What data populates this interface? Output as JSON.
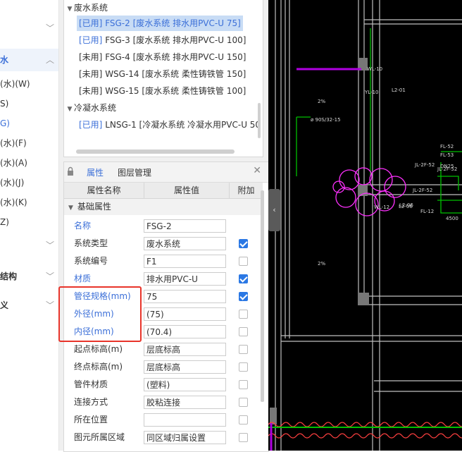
{
  "leftnav": {
    "items": [
      {
        "label": "",
        "chevron": true
      },
      {
        "label": "水",
        "chevron": true,
        "selected": true
      },
      {
        "label": "(水)(W)"
      },
      {
        "label": "S)"
      },
      {
        "label": "G)",
        "blue": true
      },
      {
        "label": "(水)(F)"
      },
      {
        "label": "(水)(A)"
      },
      {
        "label": "(水)(J)"
      },
      {
        "label": "(水)(K)"
      },
      {
        "label": "Z)"
      },
      {
        "label": "",
        "chevron": true
      },
      {
        "label": "结构",
        "chevron": true
      },
      {
        "label": "义",
        "chevron": true
      }
    ]
  },
  "tree": {
    "group1": "废水系统",
    "items1": [
      {
        "tag": "[已用]",
        "text": " FSG-2 [废水系统 排水用PVC-U 75]",
        "selected": true
      },
      {
        "tag": "[已用]",
        "text": " FSG-3 [废水系统 排水用PVC-U 100]"
      },
      {
        "tag": "[未用]",
        "text": " FSG-4 [废水系统 排水用PVC-U 150]"
      },
      {
        "tag": "[未用]",
        "text": " WSG-14 [废水系统 柔性铸铁管 150]"
      },
      {
        "tag": "[未用]",
        "text": " WSG-15 [废水系统 柔性铸铁管 100]"
      }
    ],
    "group2": "冷凝水系统",
    "items2": [
      {
        "tag": "[已用]",
        "text": " LNSG-1 [冷凝水系统 冷凝水用PVC-U 50"
      }
    ]
  },
  "panel": {
    "tab_props": "属性",
    "tab_layers": "图层管理",
    "col_name": "属性名称",
    "col_value": "属性值",
    "col_extra": "附加",
    "section": "基础属性",
    "rows": [
      {
        "name": "名称",
        "value": "FSG-2",
        "blue": true,
        "check": "none"
      },
      {
        "name": "系统类型",
        "value": "废水系统",
        "check": "on"
      },
      {
        "name": "系统编号",
        "value": "F1",
        "check": "off"
      },
      {
        "name": "材质",
        "value": "排水用PVC-U",
        "blue": true,
        "check": "on"
      },
      {
        "name": "管径规格(mm)",
        "value": "75",
        "blue": true,
        "check": "on"
      },
      {
        "name": "外径(mm)",
        "value": "(75)",
        "blue": true,
        "check": "off"
      },
      {
        "name": "内径(mm)",
        "value": "(70.4)",
        "blue": true,
        "check": "off"
      },
      {
        "name": "起点标高(m)",
        "value": "层底标高",
        "check": "off"
      },
      {
        "name": "终点标高(m)",
        "value": "层底标高",
        "check": "off"
      },
      {
        "name": "管件材质",
        "value": "(塑料)",
        "check": "off"
      },
      {
        "name": "连接方式",
        "value": "胶粘连接",
        "check": "off"
      },
      {
        "name": "所在位置",
        "value": "",
        "check": "off"
      },
      {
        "name": "图元所属区域",
        "value": "同区域归属设置",
        "check": "off"
      }
    ]
  },
  "cad": {
    "labels": [
      "WL-10",
      "L2-01",
      "YL-10",
      "2%",
      "ø 90S/32-15",
      "L2-06",
      "JL-2F-52",
      "FL-52",
      "FL-53",
      "JL-2F-52",
      "DN25",
      "JL-2F-52",
      "WL-12",
      "L2-06",
      "FL-12",
      "4500",
      "2%"
    ]
  },
  "colors": {
    "accent": "#3b6fd8",
    "selection": "#c8dcf5",
    "highlight": "#e8342a",
    "cad_bg": "#000000"
  }
}
